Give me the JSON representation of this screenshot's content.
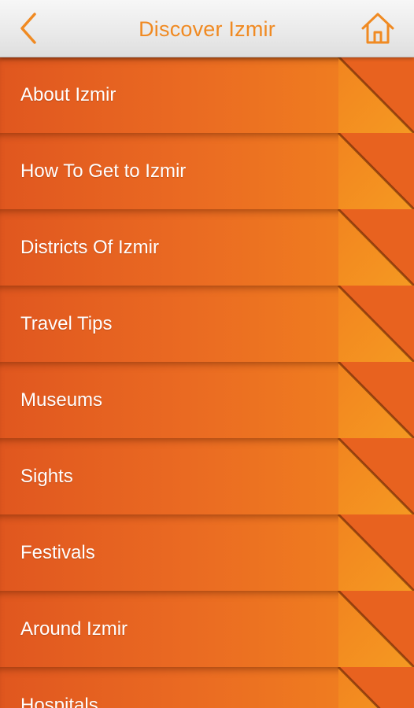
{
  "header": {
    "title": "Discover Izmir",
    "back_icon": "chevron-left-icon",
    "home_icon": "home-icon",
    "accent_color": "#f08a22"
  },
  "menu": {
    "items": [
      {
        "label": "About Izmir"
      },
      {
        "label": "How To Get to Izmir"
      },
      {
        "label": "Districts Of Izmir"
      },
      {
        "label": "Travel Tips"
      },
      {
        "label": "Museums"
      },
      {
        "label": "Sights"
      },
      {
        "label": "Festivals"
      },
      {
        "label": "Around Izmir"
      },
      {
        "label": "Hospitals"
      }
    ],
    "colors": {
      "dark": "#e0571f",
      "mid": "#ea6a22",
      "light": "#f2851f",
      "fold_light": "#f59a22"
    }
  }
}
